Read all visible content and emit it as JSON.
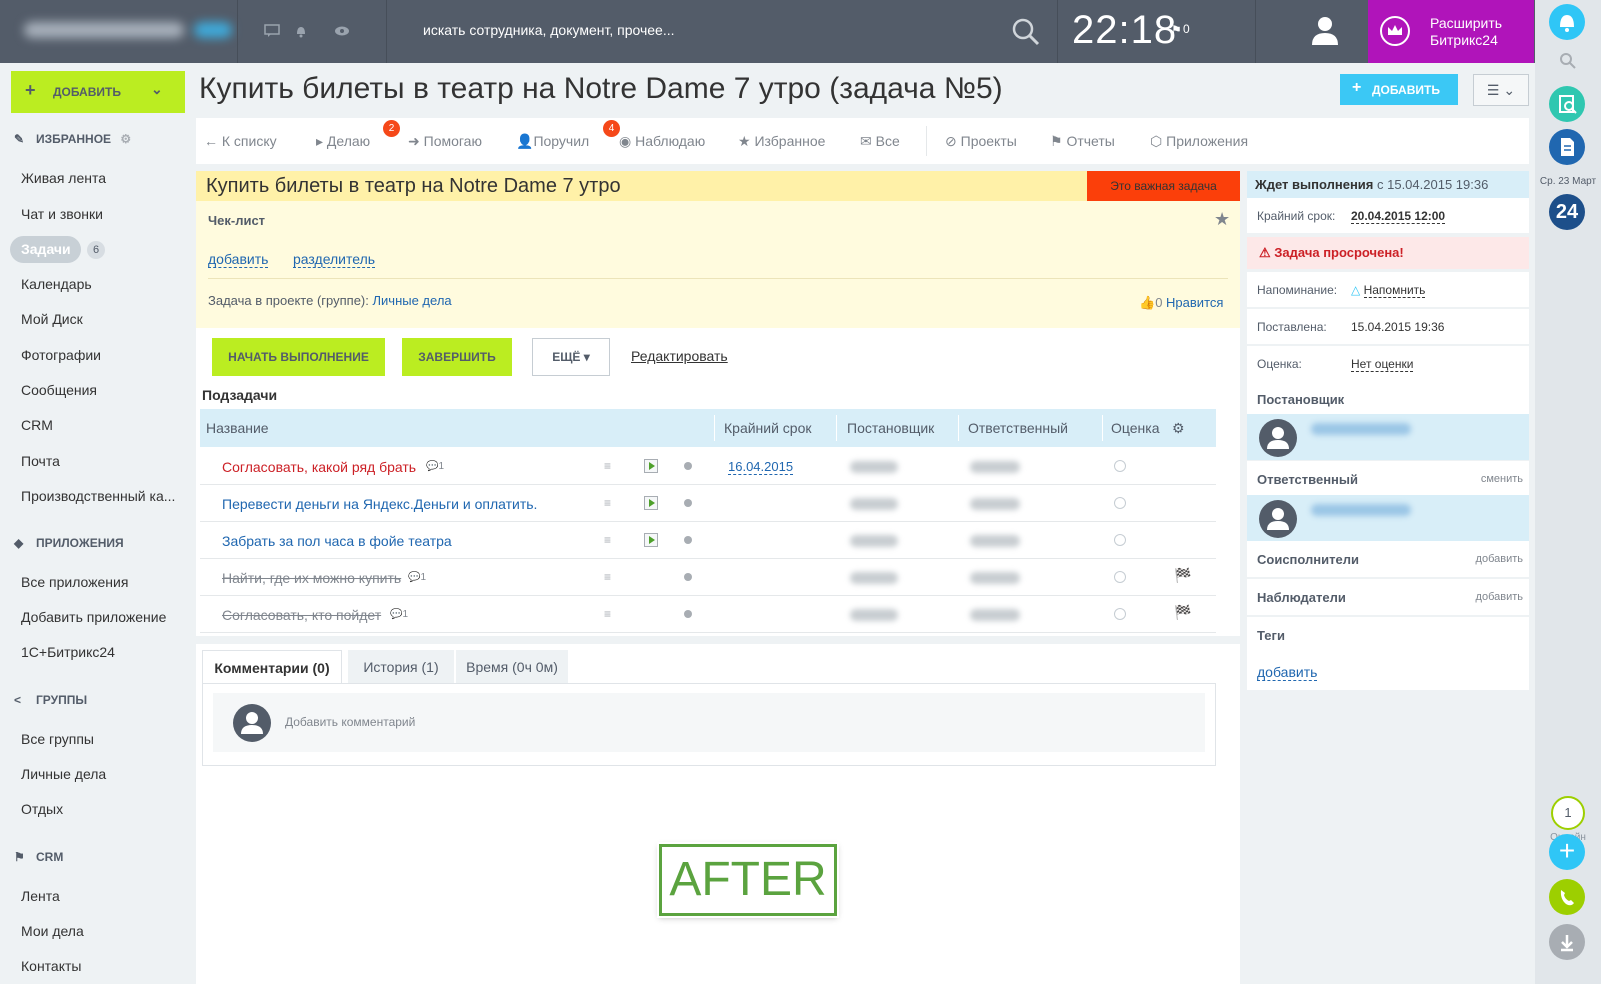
{
  "topbar": {
    "search_placeholder": "искать сотрудника, документ, прочее...",
    "clock": "22:18",
    "flag_count": "0",
    "expand_line1": "Расширить",
    "expand_line2": "Битрикс24",
    "expand_color": "#b014ba"
  },
  "right_strip": {
    "date": "Ср. 23 Март",
    "online_count": "1",
    "online_label": "Онлайн"
  },
  "sidebar": {
    "add_label": "ДОБАВИТЬ",
    "favorites_title": "ИЗБРАННОЕ",
    "favorites": [
      "Живая лента",
      "Чат и звонки",
      "Задачи",
      "Календарь",
      "Мой Диск",
      "Фотографии",
      "Сообщения",
      "CRM",
      "Почта",
      "Производственный ка..."
    ],
    "tasks_badge": "6",
    "apps_title": "ПРИЛОЖЕНИЯ",
    "apps": [
      "Все приложения",
      "Добавить приложение",
      "1С+Битрикс24"
    ],
    "groups_title": "ГРУППЫ",
    "groups": [
      "Все группы",
      "Личные дела",
      "Отдых"
    ],
    "crm_title": "CRM",
    "crm": [
      "Лента",
      "Мои дела",
      "Контакты"
    ]
  },
  "page": {
    "title": "Купить билеты в театр на Notre Dame 7 утро (задача №5)",
    "add_button": "ДОБАВИТЬ"
  },
  "nav": {
    "back": "← К списку",
    "doing": "Делаю",
    "doing_badge": "2",
    "helping": "Помогаю",
    "assigned": "Поручил",
    "assigned_badge": "4",
    "watching": "Наблюдаю",
    "favorites": "Избранное",
    "all": "Все",
    "projects": "Проекты",
    "reports": "Отчеты",
    "apps": "Приложения"
  },
  "task": {
    "title": "Купить билеты в театр на Notre Dame 7 утро",
    "important": "Это важная задача",
    "checklist": "Чек-лист",
    "add_link": "добавить",
    "separator_link": "разделитель",
    "project_label": "Задача в проекте (группе):",
    "project_name": "Личные дела",
    "likes_count": "0",
    "like_label": "Нравится",
    "start_button": "НАЧАТЬ ВЫПОЛНЕНИЕ",
    "finish_button": "ЗАВЕРШИТЬ",
    "more_button": "ЕЩЁ",
    "edit_link": "Редактировать"
  },
  "subtasks": {
    "heading": "Подзадачи",
    "columns": [
      "Название",
      "Крайний срок",
      "Постановщик",
      "Ответственный",
      "Оценка"
    ],
    "rows": [
      {
        "name": "Согласовать, какой ряд брать",
        "comments": "1",
        "deadline": "16.04.2015",
        "style": "red"
      },
      {
        "name": "Перевести деньги на Яндекс.Деньги и оплатить.",
        "comments": "",
        "deadline": "",
        "style": "blue"
      },
      {
        "name": "Забрать за пол часа в фойе театра",
        "comments": "",
        "deadline": "",
        "style": "blue"
      },
      {
        "name": "Найти, где их можно купить",
        "comments": "1",
        "deadline": "",
        "style": "strike"
      },
      {
        "name": "Согласовать, кто пойдет",
        "comments": "1",
        "deadline": "",
        "style": "strike"
      }
    ]
  },
  "comments": {
    "tab_comments": "Комментарии (0)",
    "tab_history": "История (1)",
    "tab_time": "Время (0ч 0м)",
    "placeholder": "Добавить комментарий"
  },
  "after_label": "AFTER",
  "right_panel": {
    "status_prefix": "Ждет выполнения",
    "status_date": "с 15.04.2015 19:36",
    "deadline_label": "Крайний срок:",
    "deadline_value": "20.04.2015 12:00",
    "overdue": "Задача просрочена!",
    "reminder_label": "Напоминание:",
    "reminder_value": "Напомнить",
    "created_label": "Поставлена:",
    "created_value": "15.04.2015 19:36",
    "rating_label": "Оценка:",
    "rating_value": "Нет оценки",
    "creator_title": "Постановщик",
    "responsible_title": "Ответственный",
    "responsible_change": "сменить",
    "coexecutors_title": "Соисполнители",
    "coexecutors_add": "добавить",
    "observers_title": "Наблюдатели",
    "observers_add": "добавить",
    "tags_title": "Теги",
    "tags_add": "добавить"
  }
}
